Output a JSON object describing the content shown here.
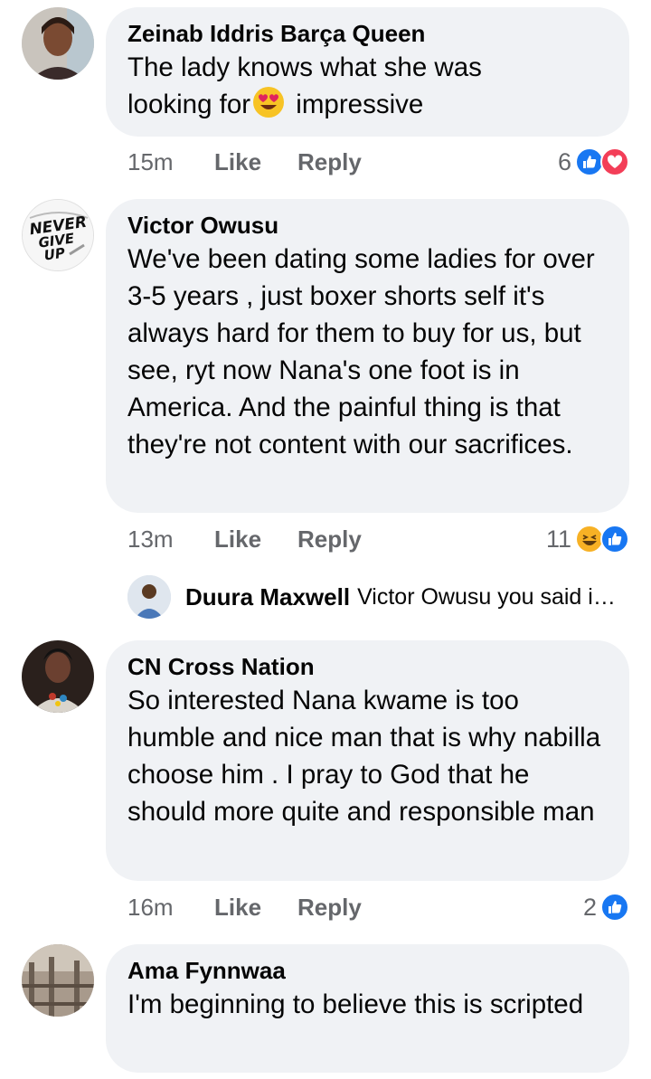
{
  "comments": [
    {
      "author": "Zeinab Iddris Barça Queen",
      "text_line1": "The lady knows what she was",
      "text_before_emoji": "looking for",
      "text_after_emoji": " impressive",
      "time": "15m",
      "like_label": "Like",
      "reply_label": "Reply",
      "reaction_count": "6",
      "reactions": [
        "like-icon",
        "love-icon"
      ]
    },
    {
      "author": "Victor Owusu",
      "text": "We've been dating some ladies for over 3-5 years , just boxer shorts self it's always hard for them to buy for us, but see, ryt now Nana's one foot is in America. And the painful thing is that they're not content with our sacrifices.",
      "time": "13m",
      "like_label": "Like",
      "reply_label": "Reply",
      "reaction_count": "11",
      "reactions": [
        "haha-icon",
        "like-icon"
      ],
      "avatar_text": [
        "NEVER",
        "GIVE",
        "UP"
      ]
    },
    {
      "author": "CN Cross Nation",
      "text": "So interested Nana kwame is too humble and nice man that is why nabilla choose him . I pray to God that he should more quite and responsible man",
      "time": "16m",
      "like_label": "Like",
      "reply_label": "Reply",
      "reaction_count": "2",
      "reactions": [
        "like-icon"
      ]
    },
    {
      "author": "Ama Fynnwaa",
      "text": "I'm beginning to believe this is scripted"
    }
  ],
  "reply_preview": {
    "author": "Duura Maxwell",
    "snippet": "Victor Owusu you said i…"
  },
  "colors": {
    "bubble": "#f0f2f5",
    "meta_text": "#65676b",
    "like_blue": "#1877f2",
    "love_red": "#f33e58",
    "haha_yellow": "#f7b125"
  }
}
